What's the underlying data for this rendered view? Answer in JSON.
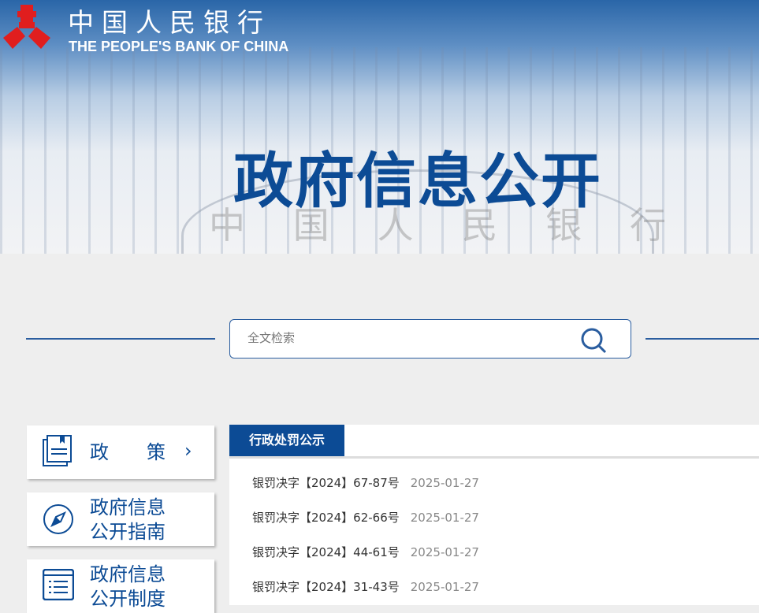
{
  "header": {
    "logo_cn": "中国人民银行",
    "logo_en": "THE PEOPLE'S BANK OF CHINA",
    "title": "政府信息公开",
    "watermark": [
      "中",
      "国",
      "人",
      "民",
      "银",
      "行"
    ]
  },
  "search": {
    "placeholder": "全文检索"
  },
  "sidebar": {
    "items": [
      {
        "label": "政　　策",
        "icon": "book-icon"
      },
      {
        "label1": "政府信息",
        "label2": "公开指南",
        "icon": "compass-icon"
      },
      {
        "label1": "政府信息",
        "label2": "公开制度",
        "icon": "list-icon"
      }
    ]
  },
  "panel": {
    "tab": "行政处罚公示",
    "rows": [
      {
        "title": "银罚决字【2024】67-87号",
        "date": "2025-01-27"
      },
      {
        "title": "银罚决字【2024】62-66号",
        "date": "2025-01-27"
      },
      {
        "title": "银罚决字【2024】44-61号",
        "date": "2025-01-27"
      },
      {
        "title": "银罚决字【2024】31-43号",
        "date": "2025-01-27"
      }
    ]
  }
}
